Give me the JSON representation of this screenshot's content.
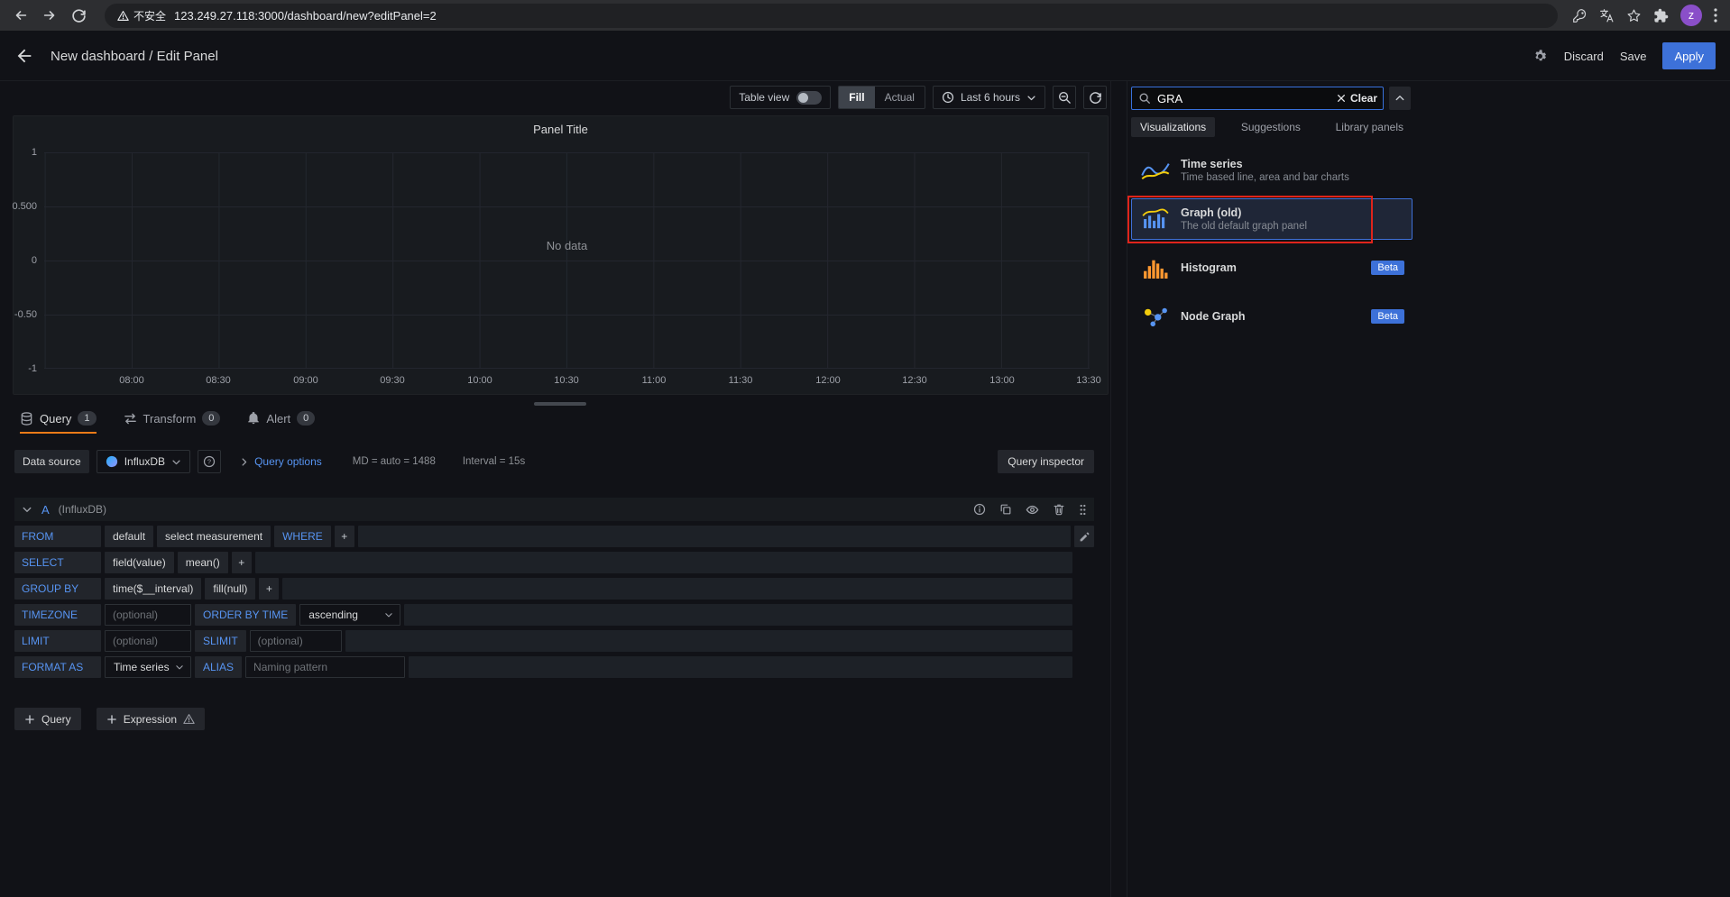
{
  "browser": {
    "security_label": "不安全",
    "url": "123.249.27.118:3000/dashboard/new?editPanel=2",
    "avatar": "z"
  },
  "header": {
    "title": "New dashboard / Edit Panel",
    "discard_label": "Discard",
    "save_label": "Save",
    "apply_label": "Apply"
  },
  "toolbar": {
    "table_view_label": "Table view",
    "fill_label": "Fill",
    "actual_label": "Actual",
    "time_range_label": "Last 6 hours"
  },
  "chart_data": {
    "type": "line",
    "title": "Panel Title",
    "no_data_text": "No data",
    "x_ticks": [
      "08:00",
      "08:30",
      "09:00",
      "09:30",
      "10:00",
      "10:30",
      "11:00",
      "11:30",
      "12:00",
      "12:30",
      "13:00",
      "13:30"
    ],
    "y_ticks": [
      "1",
      "0.500",
      "0",
      "-0.50",
      "-1"
    ],
    "ylim": [
      -1,
      1
    ],
    "series": [],
    "grid": true,
    "legend": "none"
  },
  "query_tabs": {
    "query_label": "Query",
    "query_count": "1",
    "transform_label": "Transform",
    "transform_count": "0",
    "alert_label": "Alert",
    "alert_count": "0"
  },
  "query": {
    "datasource_label": "Data source",
    "datasource_value": "InfluxDB",
    "options_label": "Query options",
    "md_text": "MD = auto = 1488",
    "interval_text": "Interval = 15s",
    "inspector_label": "Query inspector",
    "ref_id": "A",
    "ref_ds": "(InfluxDB)",
    "from_label": "FROM",
    "from_default": "default",
    "from_measurement": "select measurement",
    "where_label": "WHERE",
    "select_label": "SELECT",
    "select_field": "field(value)",
    "select_func": "mean()",
    "groupby_label": "GROUP BY",
    "groupby_time": "time($__interval)",
    "groupby_fill": "fill(null)",
    "timezone_label": "TIMEZONE",
    "optional_placeholder": "(optional)",
    "orderby_label": "ORDER BY TIME",
    "orderby_value": "ascending",
    "limit_label": "LIMIT",
    "slimit_label": "SLIMIT",
    "format_label": "FORMAT AS",
    "format_value": "Time series",
    "alias_label": "ALIAS",
    "alias_placeholder": "Naming pattern",
    "plus": "+",
    "add_query_label": "Query",
    "add_expression_label": "Expression"
  },
  "vis_picker": {
    "search_value": "GRA",
    "clear_label": "Clear",
    "tab_visualizations": "Visualizations",
    "tab_suggestions": "Suggestions",
    "tab_library": "Library panels",
    "items": [
      {
        "name": "Time series",
        "desc": "Time based line, area and bar charts",
        "badge": ""
      },
      {
        "name": "Graph (old)",
        "desc": "The old default graph panel",
        "badge": ""
      },
      {
        "name": "Histogram",
        "desc": "",
        "badge": "Beta"
      },
      {
        "name": "Node Graph",
        "desc": "",
        "badge": "Beta"
      }
    ]
  }
}
